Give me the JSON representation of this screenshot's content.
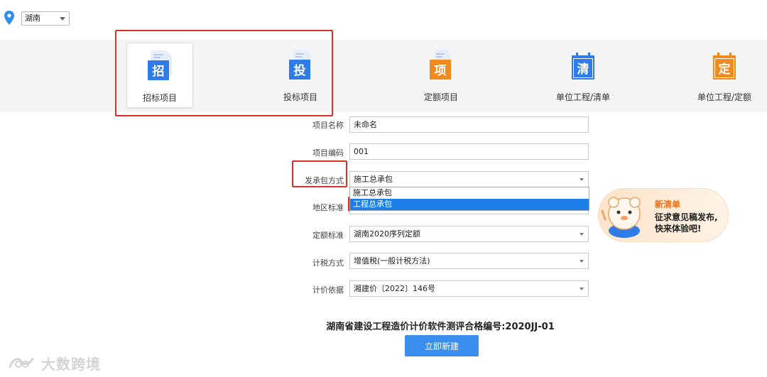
{
  "top": {
    "region": "湖南",
    "icon": "location-pin-icon"
  },
  "categories": [
    {
      "label": "招标项目",
      "glyph": "招",
      "color": "#2f7be8",
      "icon": "bid-invitation-doc-icon",
      "selected": true
    },
    {
      "label": "投标项目",
      "glyph": "投",
      "color": "#2f7be8",
      "icon": "bid-submission-doc-icon",
      "selected": false
    },
    {
      "label": "定额项目",
      "glyph": "项",
      "color": "#f08a1c",
      "icon": "quota-project-doc-icon",
      "selected": false
    },
    {
      "label": "单位工程/清单",
      "glyph": "清",
      "color": "#2f7be8",
      "icon": "bill-doc-icon",
      "selected": false
    },
    {
      "label": "单位工程/定额",
      "glyph": "定",
      "color": "#f08a1c",
      "icon": "quota-doc-icon",
      "selected": false
    }
  ],
  "form": {
    "project_name": {
      "label": "项目名称",
      "value": "未命名"
    },
    "project_code": {
      "label": "项目编码",
      "value": "001"
    },
    "contract_mode": {
      "label": "发承包方式",
      "value": "施工总承包",
      "options": [
        "施工总承包",
        "工程总承包"
      ],
      "highlighted": "工程总承包"
    },
    "region_standard": {
      "label": "地区标准",
      "value": ""
    },
    "quota_standard": {
      "label": "定额标准",
      "value": "湖南2020序列定额"
    },
    "tax_method": {
      "label": "计税方式",
      "value": "增值税(一般计税方法)"
    },
    "pricing_basis": {
      "label": "计价依据",
      "value": "湘建价〔2022〕146号"
    }
  },
  "promo": {
    "title": "新清单",
    "line1": "征求意见稿发布,",
    "line2": "快来体验吧!"
  },
  "certificate": "湖南省建设工程造价计价软件测评合格编号:2020JJ-01",
  "create_button": "立即新建",
  "watermark": "大数跨境",
  "colors": {
    "accent": "#3a8ef0",
    "highlight": "#d9302c",
    "selected_option": "#1e7fe8"
  }
}
